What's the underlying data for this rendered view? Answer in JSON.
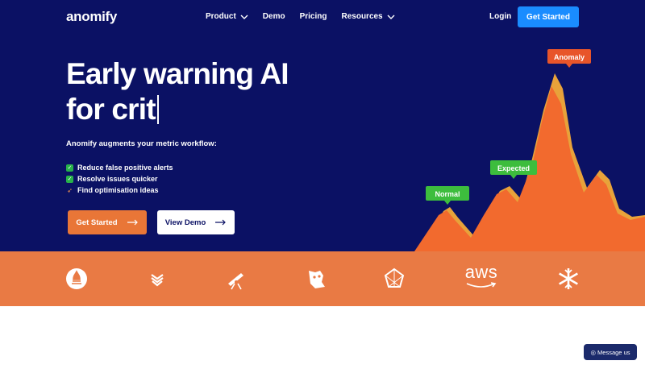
{
  "brand": {
    "logo_text": "anomify"
  },
  "nav": {
    "items": [
      {
        "label": "Product",
        "dropdown": true
      },
      {
        "label": "Demo",
        "dropdown": false
      },
      {
        "label": "Pricing",
        "dropdown": false
      },
      {
        "label": "Resources",
        "dropdown": true
      }
    ],
    "login_label": "Login",
    "get_started_label": "Get Started"
  },
  "hero": {
    "headline_line1": "Early warning AI",
    "headline_line2": "for crit",
    "subtitle": "Anomify augments your metric workflow:",
    "bullets": [
      {
        "icon": "check-icon",
        "text": "Reduce false positive alerts"
      },
      {
        "icon": "check-icon",
        "text": "Resolve issues quicker"
      },
      {
        "icon": "rocket-icon",
        "text": "Find optimisation ideas"
      }
    ],
    "cta_primary": "Get Started",
    "cta_secondary": "View Demo"
  },
  "chart_labels": {
    "normal": "Normal",
    "expected": "Expected",
    "anomaly": "Anomaly"
  },
  "integrations": [
    "prometheus-icon",
    "victoriametrics-icon",
    "telescope-icon",
    "datadog-icon",
    "grafana-icon",
    "aws-icon",
    "snowflake-icon"
  ],
  "aws_text": "aws",
  "message_widget": {
    "label": "Message us"
  },
  "colors": {
    "hero_bg": "#0b1164",
    "accent_orange": "#e97637",
    "accent_blue": "#1a8cff",
    "label_green": "#3dbd3d",
    "anomaly_red": "#e8552a"
  }
}
